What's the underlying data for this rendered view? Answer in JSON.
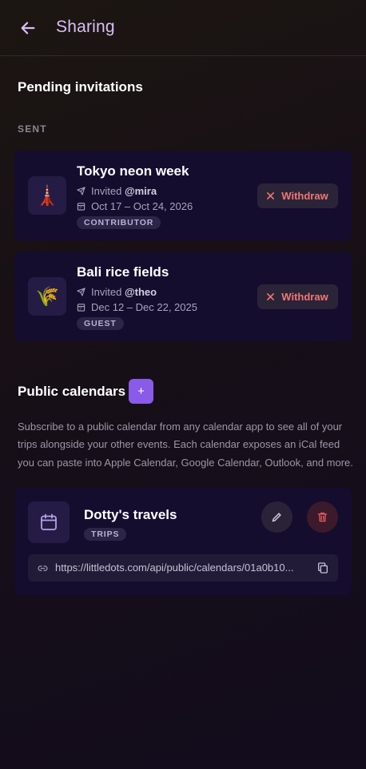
{
  "header": {
    "title": "Sharing",
    "back_icon": "arrow-left-icon"
  },
  "pending": {
    "title": "Pending invitations",
    "sent_label": "SENT",
    "invites": [
      {
        "emoji": "🗼",
        "name": "Tokyo neon week",
        "invited_prefix": "Invited",
        "invitee": "@mira",
        "dates": "Oct 17 – Oct 24, 2026",
        "role": "CONTRIBUTOR",
        "action": "Withdraw"
      },
      {
        "emoji": "🌾",
        "name": "Bali rice fields",
        "invited_prefix": "Invited",
        "invitee": "@theo",
        "dates": "Dec 12 – Dec 22, 2025",
        "role": "GUEST",
        "action": "Withdraw"
      }
    ]
  },
  "public_calendars": {
    "title": "Public calendars",
    "add_label": "+",
    "description": "Subscribe to a public calendar from any calendar app to see all of your trips alongside your other events. Each calendar exposes an iCal feed you can paste into Apple Calendar, Google Calendar, Outlook, and more.",
    "calendars": [
      {
        "name": "Dotty's travels",
        "badge": "TRIPS",
        "url": "https://littledots.com/api/public/calendars/01a0b10..."
      }
    ]
  },
  "colors": {
    "accent": "#8a5ae8",
    "danger": "#f07774",
    "card": "#150d2e",
    "title": "#d9bff7"
  }
}
